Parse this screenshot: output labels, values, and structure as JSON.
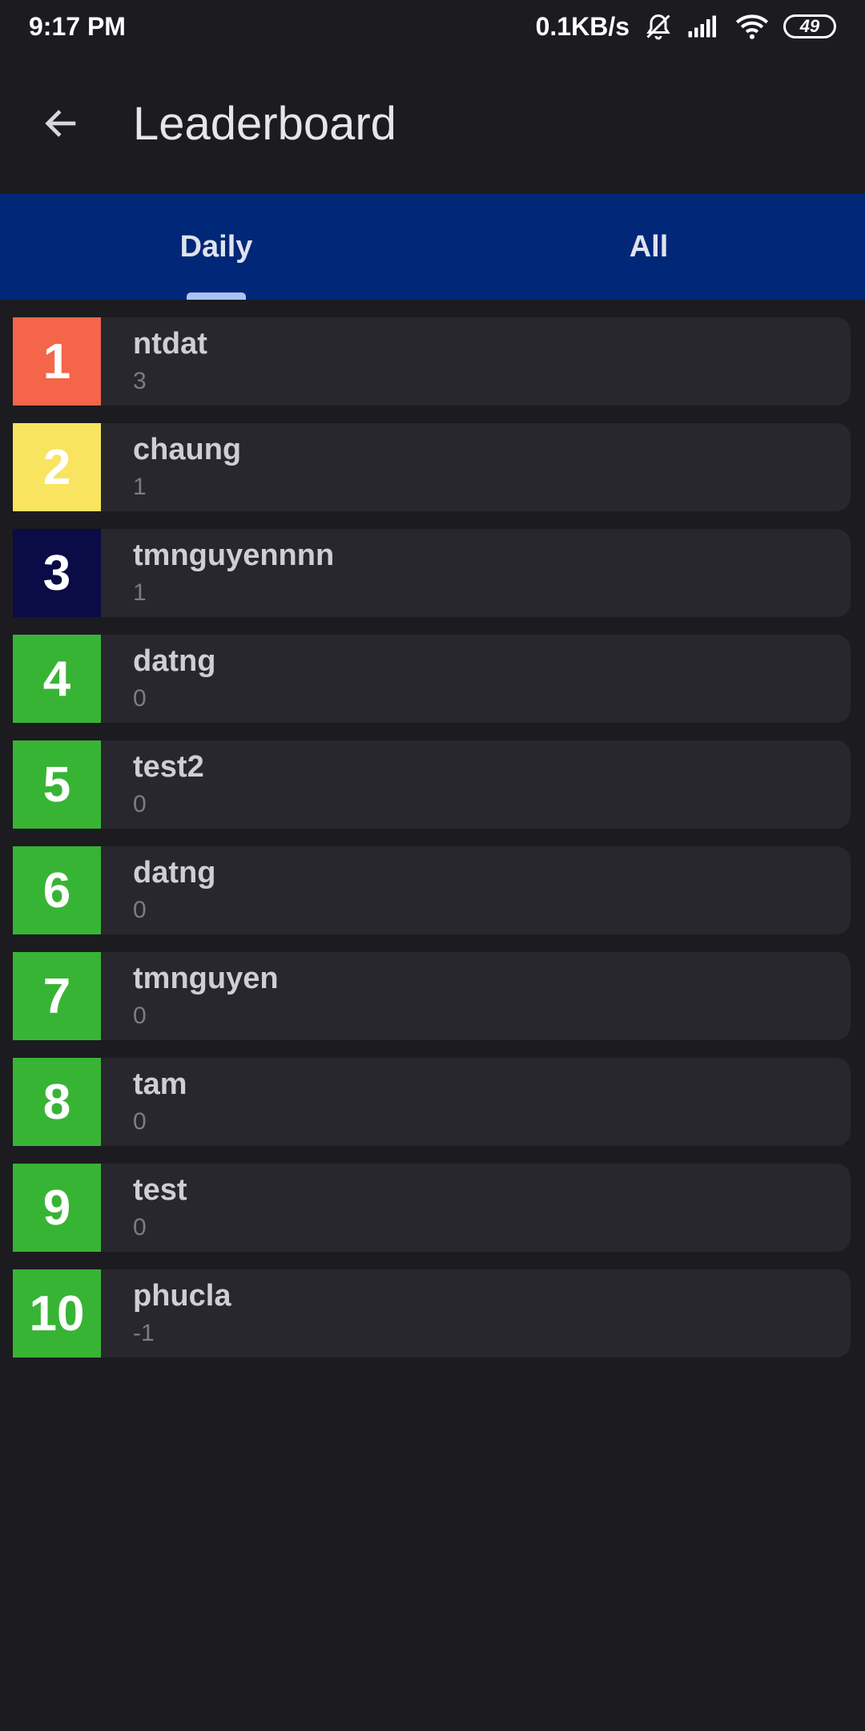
{
  "status_bar": {
    "time": "9:17 PM",
    "net_speed": "0.1KB/s",
    "battery": "49",
    "icons": [
      "mute-icon",
      "signal-icon",
      "wifi-icon",
      "battery-icon"
    ]
  },
  "app_bar": {
    "title": "Leaderboard",
    "back_icon": "arrow-left-icon"
  },
  "tabs": [
    {
      "label": "Daily",
      "selected": true
    },
    {
      "label": "All",
      "selected": false
    }
  ],
  "colors": {
    "rank_1": "#f4654a",
    "rank_2": "#f9e45f",
    "rank_3": "#0b0b47",
    "rank_other": "#38b435",
    "tab_bar": "#012779"
  },
  "leaderboard": [
    {
      "rank": "1",
      "name": "ntdat",
      "score": "3",
      "color": "#f4654a"
    },
    {
      "rank": "2",
      "name": "chaung",
      "score": "1",
      "color": "#f9e45f"
    },
    {
      "rank": "3",
      "name": "tmnguyennnn",
      "score": "1",
      "color": "#0b0b47"
    },
    {
      "rank": "4",
      "name": "datng",
      "score": "0",
      "color": "#38b435"
    },
    {
      "rank": "5",
      "name": "test2",
      "score": "0",
      "color": "#38b435"
    },
    {
      "rank": "6",
      "name": "datng",
      "score": "0",
      "color": "#38b435"
    },
    {
      "rank": "7",
      "name": "tmnguyen",
      "score": "0",
      "color": "#38b435"
    },
    {
      "rank": "8",
      "name": "tam",
      "score": "0",
      "color": "#38b435"
    },
    {
      "rank": "9",
      "name": "test",
      "score": "0",
      "color": "#38b435"
    },
    {
      "rank": "10",
      "name": "phucla",
      "score": "-1",
      "color": "#38b435"
    }
  ]
}
